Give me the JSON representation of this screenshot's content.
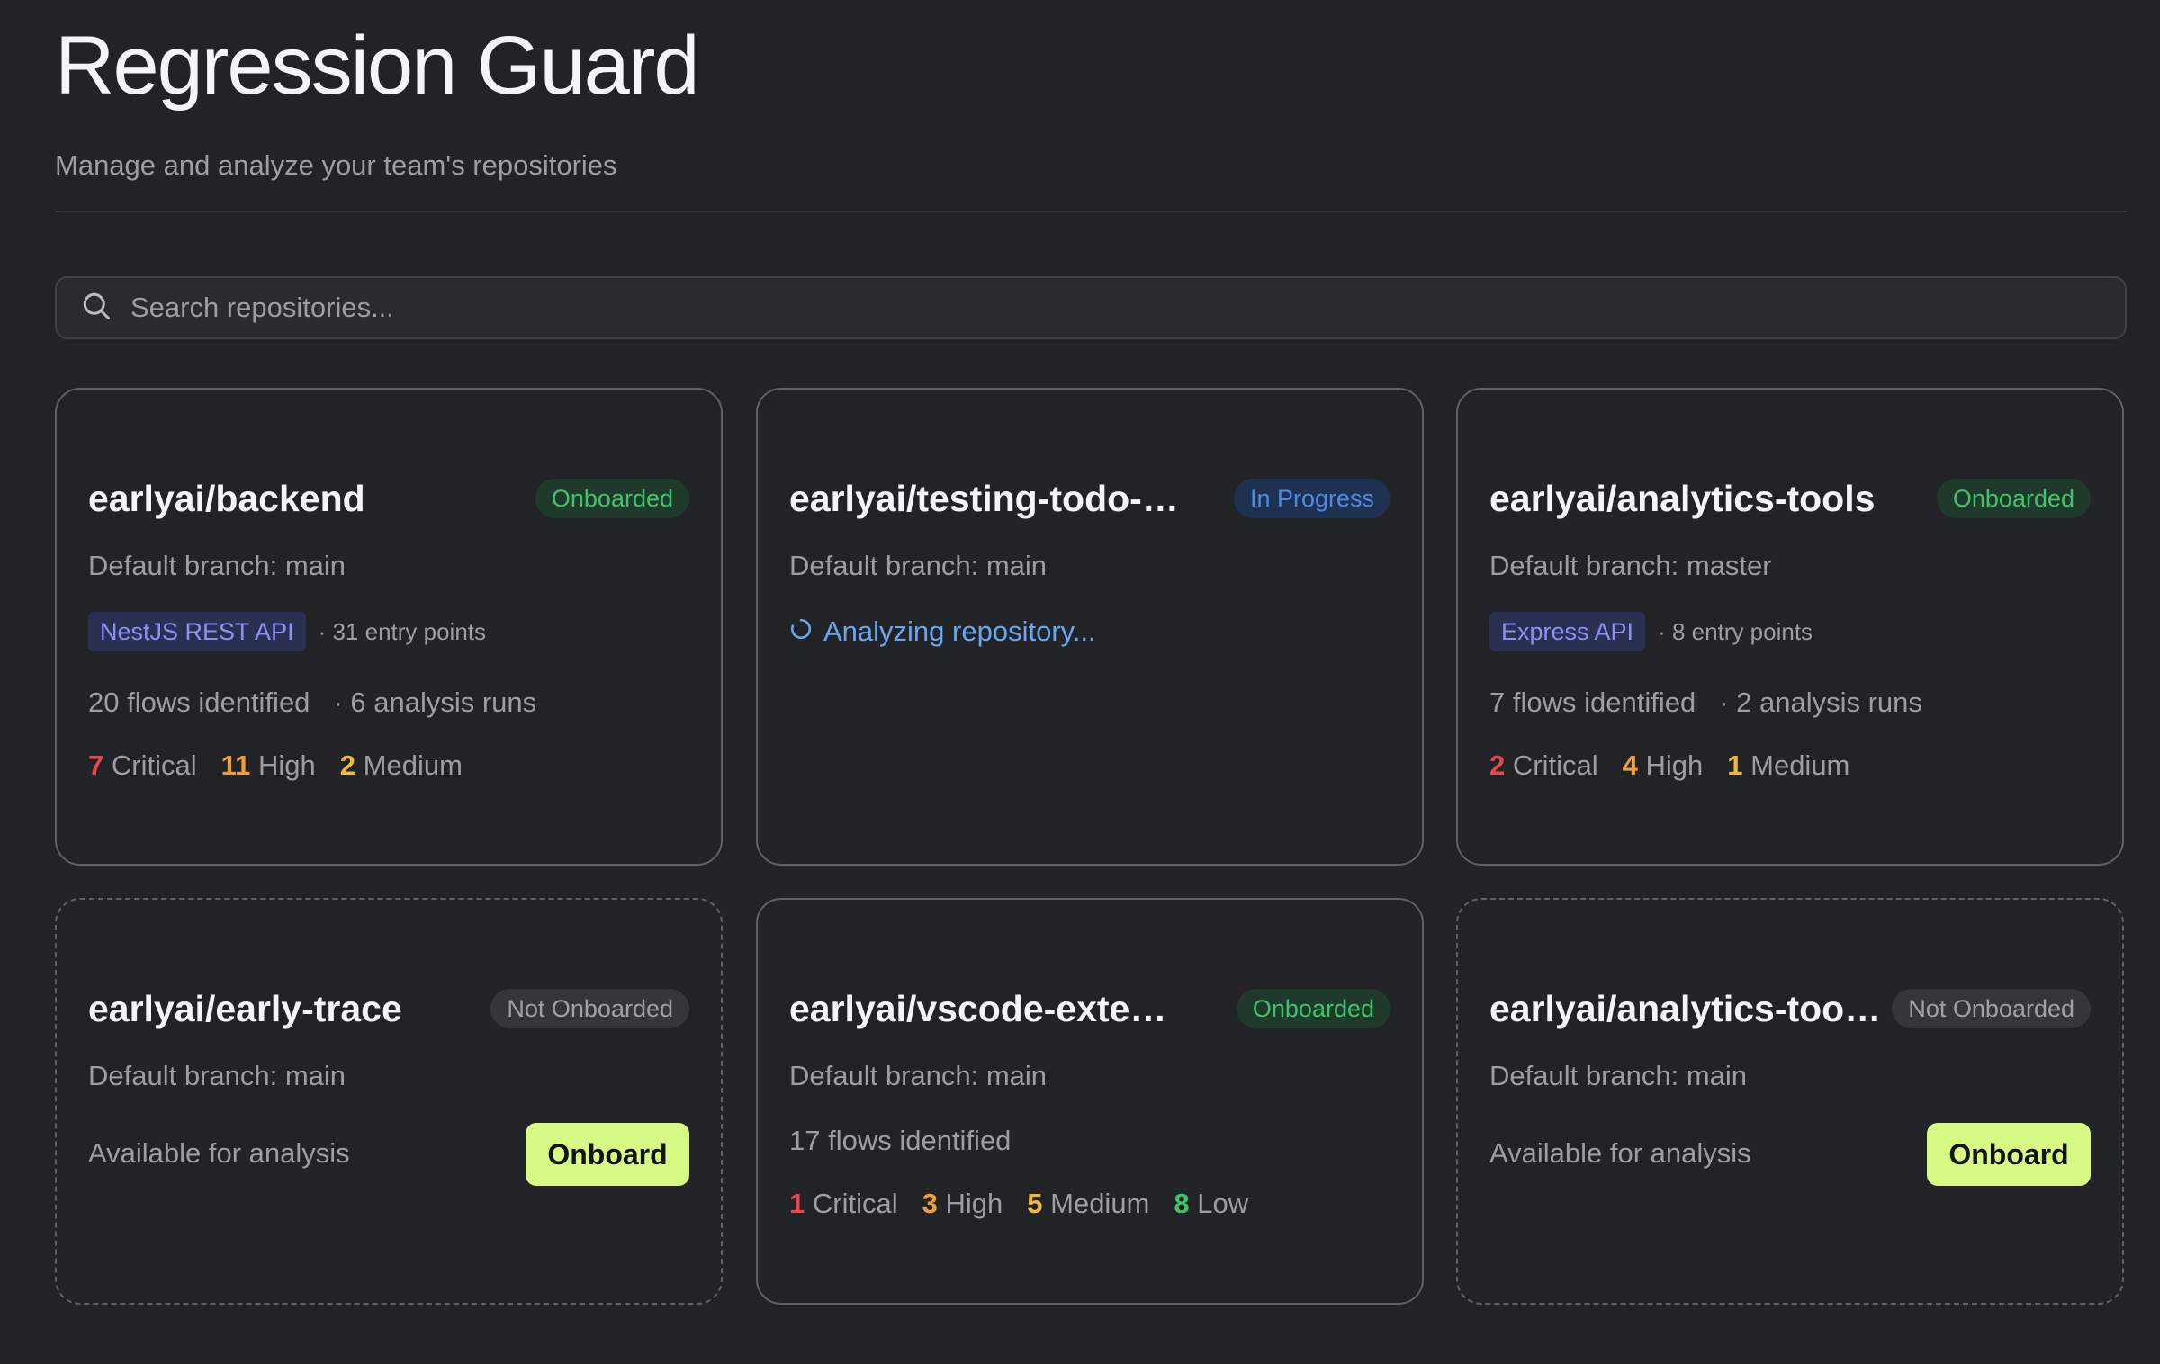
{
  "header": {
    "title": "Regression Guard",
    "subtitle": "Manage and analyze your team's repositories"
  },
  "search": {
    "placeholder": "Search repositories...",
    "icon": "search-icon"
  },
  "colors": {
    "accent_button": "#d7fa85",
    "critical": "#e5484d",
    "high": "#f29b38",
    "medium": "#f0b93a",
    "low": "#3fc36b",
    "onboarded": "#3fc36b",
    "in_progress": "#4b8be8"
  },
  "repos": [
    {
      "name": "earlyai/backend",
      "status": "Onboarded",
      "branch": "Default branch: main",
      "framework": "NestJS REST API",
      "entry_points": "· 31 entry points",
      "flows": "20 flows identified",
      "runs": "· 6 analysis runs",
      "critical": "7",
      "critical_label": "Critical",
      "high": "11",
      "high_label": "High",
      "medium": "2",
      "medium_label": "Medium"
    },
    {
      "name": "earlyai/testing-todo-app",
      "status": "In Progress",
      "branch": "Default branch: main",
      "analyzing": "Analyzing repository..."
    },
    {
      "name": "earlyai/analytics-tools",
      "status": "Onboarded",
      "branch": "Default branch: master",
      "framework": "Express API",
      "entry_points": "· 8 entry points",
      "flows": "7 flows identified",
      "runs": "· 2 analysis runs",
      "critical": "2",
      "critical_label": "Critical",
      "high": "4",
      "high_label": "High",
      "medium": "1",
      "medium_label": "Medium"
    },
    {
      "name": "earlyai/early-trace",
      "status": "Not Onboarded",
      "branch": "Default branch: main",
      "availability": "Available for analysis",
      "action": "Onboard"
    },
    {
      "name": "earlyai/vscode-extension",
      "status": "Onboarded",
      "branch": "Default branch: main",
      "flows": "17 flows identified",
      "critical": "1",
      "critical_label": "Critical",
      "high": "3",
      "high_label": "High",
      "medium": "5",
      "medium_label": "Medium",
      "low": "8",
      "low_label": "Low"
    },
    {
      "name": "earlyai/analytics-tools-...",
      "status": "Not Onboarded",
      "branch": "Default branch: main",
      "availability": "Available for analysis",
      "action": "Onboard"
    }
  ]
}
